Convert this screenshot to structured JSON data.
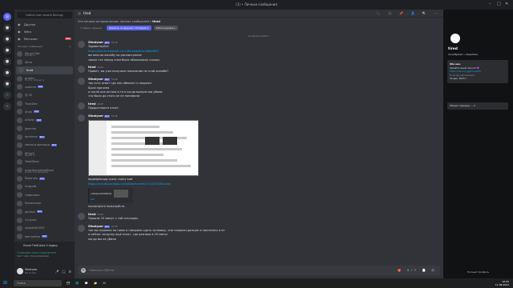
{
  "window": {
    "title": "(1) • Личные сообщения"
  },
  "sidebar": {
    "search_placeholder": "Найти или начать беседу",
    "nav": [
      {
        "label": "Друзья",
        "icon": "friends-icon"
      },
      {
        "label": "Nitro",
        "icon": "nitro-icon"
      },
      {
        "label": "Магазин",
        "icon": "shop-icon",
        "badge": "NEW"
      }
    ],
    "dm_header": "Личные сообщения",
    "dms": [
      {
        "name": "Peruvi Dat",
        "sub": "Играет в ...",
        "bot": ""
      },
      {
        "name": "Xeno",
        "sub": "",
        "bot": ""
      },
      {
        "name": "tired",
        "sub": "",
        "bot": "",
        "active": true
      },
      {
        "name": "andrey",
        "sub": "В сети • Играет в ",
        "bot": ""
      },
      {
        "name": "sublime",
        "sub": "",
        "bot": "БОТ"
      },
      {
        "name": "@ 52",
        "sub": "",
        "bot": ""
      },
      {
        "name": "TrustDev",
        "sub": "",
        "bot": ""
      },
      {
        "name": "drain",
        "sub": "",
        "bot": "БОТ"
      },
      {
        "name": "artizan",
        "sub": "",
        "bot": "БОТ"
      },
      {
        "name": "Jasmine",
        "sub": "",
        "bot": ""
      },
      {
        "name": "bominoe",
        "sub": "",
        "bot": "БОТ"
      },
      {
        "name": "люськи дискорд",
        "sub": "",
        "bot": "БОТ"
      },
      {
        "name": "fiFIxeS",
        "sub": "Играет в...",
        "bot": ""
      },
      {
        "name": "YeahDean",
        "sub": "",
        "bot": ""
      },
      {
        "name": "платёжный вебхук",
        "sub": "Играет в ScreenShare",
        "bot": ""
      },
      {
        "name": "Rotoruko",
        "sub": "",
        "bot": "БОТ"
      },
      {
        "name": "Андрей",
        "sub": "",
        "bot": ""
      },
      {
        "name": "гефинкон",
        "sub": "",
        "bot": ""
      },
      {
        "name": "Безалпиях",
        "sub": "",
        "bot": ""
      },
      {
        "name": "gorasyi",
        "sub": "",
        "bot": "БОТ"
      },
      {
        "name": "Liruyluo",
        "sub": "",
        "bot": ""
      },
      {
        "name": "sulwolf#4091",
        "sub": "",
        "bot": ""
      },
      {
        "name": "kenuyiklxo",
        "sub": "",
        "bot": "БОТ"
      }
    ],
    "activity": {
      "game": "Grand Theft Auto V Legacy",
      "voice": "Голосовая связь подключена",
      "voice_sub": "Тест голос / Denis DeCamm"
    },
    "user": {
      "name": "Sfeatyser",
      "status": "Не в сети",
      "controls": "🎤 🎧 ⚙"
    }
  },
  "main": {
    "header": {
      "prefix": "@",
      "name": "tired"
    },
    "header_tools": "📞 🎥 📌 👤 🔍 ⋯",
    "banner": {
      "text": "Это начало истории ваших личных сообщений с ",
      "name": "tired",
      "mutual": "2 общих сервера",
      "btn1": "Удалить из друзей / Отправить",
      "btn2": "Заблокировать"
    },
    "date": "11 августа 2023 г.",
    "messages": [
      {
        "name": "Sfeatyser",
        "bot": "БОТ",
        "time": "10:44",
        "lines": [
          "Здравствуйте",
          "https://forum.majestic-rp.ru/threads/bm-DfKpf4tG/",
          "вы внесли жалобу на рассмотрение",
          "запыл что перед этим была обжаловану ссылку"
        ]
      },
      {
        "name": "tired",
        "bot": "",
        "time": "10:45",
        "lines": [
          "Привет, вы уже получили наказание по этой жалобе?"
        ]
      },
      {
        "name": "Sfeatyser",
        "bot": "БОТ",
        "time": "10:46",
        "lines": [
          "так есть ответ где они обманет и покраел",
          "Была причина",
          "а после она встала а то я когда выполи мы убили",
          "что было до этого он не понимали"
        ]
      },
      {
        "name": "tired",
        "bot": "",
        "time": "10:47",
        "lines": [
          "Предоставьте откат."
        ]
      },
      {
        "name": "Sfeatyser",
        "bot": "БОТ",
        "time": "10:48",
        "lines": [
          "видеорекорд сразу скину вам",
          "https://cdn.discordapp.com/attachments/11415/53/6a.png",
          "посмотрите пожалуйста"
        ]
      },
      {
        "name": "tired",
        "bot": "",
        "time": "10:54",
        "lines": [
          "Прошло 10 минут с той ситуации."
        ]
      },
      {
        "name": "Sfeatyser",
        "bot": "БОТ",
        "time": "10:55",
        "lines": [
          "так мы подняли на ними и говорили сдать оснвовку, они поорали дальше и прятались в кп",
          "а сейчас загрузку ещё откат, где разница в 10 минут",
          "когда мы их убили"
        ]
      }
    ],
    "embed": {
      "title": "chatesm0290010",
      "sub": "GIF"
    },
    "composer": {
      "placeholder": "Написать @tired",
      "tools": "🎁 GIF 📄 😊"
    }
  },
  "profile": {
    "name": "tired",
    "username": "moralfytired • dreadmoo",
    "card": {
      "header": "Обо мне",
      "line1": "Хакайте меня! discord 💜",
      "link": "https://discord.gg/meadarth",
      "member_since_label": "В числе участников с",
      "member_since": "16 дек. 2023 г."
    },
    "mutual_servers": "Общие серверы — 2",
    "full_profile": "Полный профиль"
  },
  "taskbar": {
    "search": "Поиск",
    "apps": "🗂 🌐 💬 📁 🎮",
    "time": "10:55",
    "date": "11.08.2023"
  }
}
